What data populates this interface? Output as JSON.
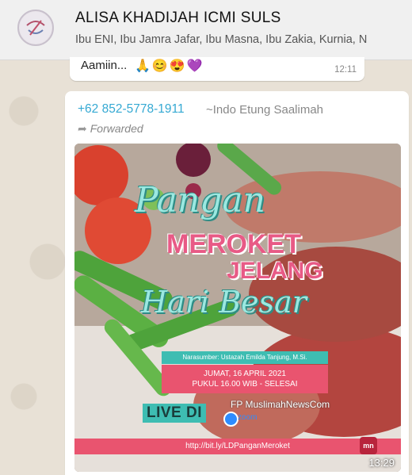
{
  "header": {
    "title": "ALISA KHADIJAH ICMI SULS",
    "members": "Ibu ENI, Ibu Jamra Jafar, Ibu Masna, Ibu Zakia, Kurnia, N",
    "avatar_icon": "group-logo-icon"
  },
  "previous_message": {
    "text": "Aamiin...",
    "emojis": "🙏😊😍💜",
    "time": "12:11"
  },
  "message": {
    "sender_phone": "+62 852-5778-1911",
    "sender_name": "~Indo Etung Saalimah",
    "forwarded_label": "Forwarded",
    "forwarded_icon": "forward-arrow-icon",
    "time": "13:29",
    "poster": {
      "title_line1": "Pangan",
      "title_line2": "MEROKET",
      "title_line3": "JELANG",
      "title_line4": "Hari Besar",
      "speaker": "Narasumber: Ustazah Emilda Tanjung, M.Si.",
      "date": "JUMAT, 16 APRIL 2021",
      "hour": "PUKUL 16.00 WIB - SELESAI",
      "live_label": "LIVE DI",
      "fb_page": "FP MuslimahNewsCom",
      "zoom_text": "zoom",
      "link": "http://bit.ly/LDPanganMeroket",
      "badge": "mn"
    }
  },
  "colors": {
    "teal": "#3ebdb2",
    "pink": "#e9546f",
    "phone_blue": "#35a9d3"
  }
}
